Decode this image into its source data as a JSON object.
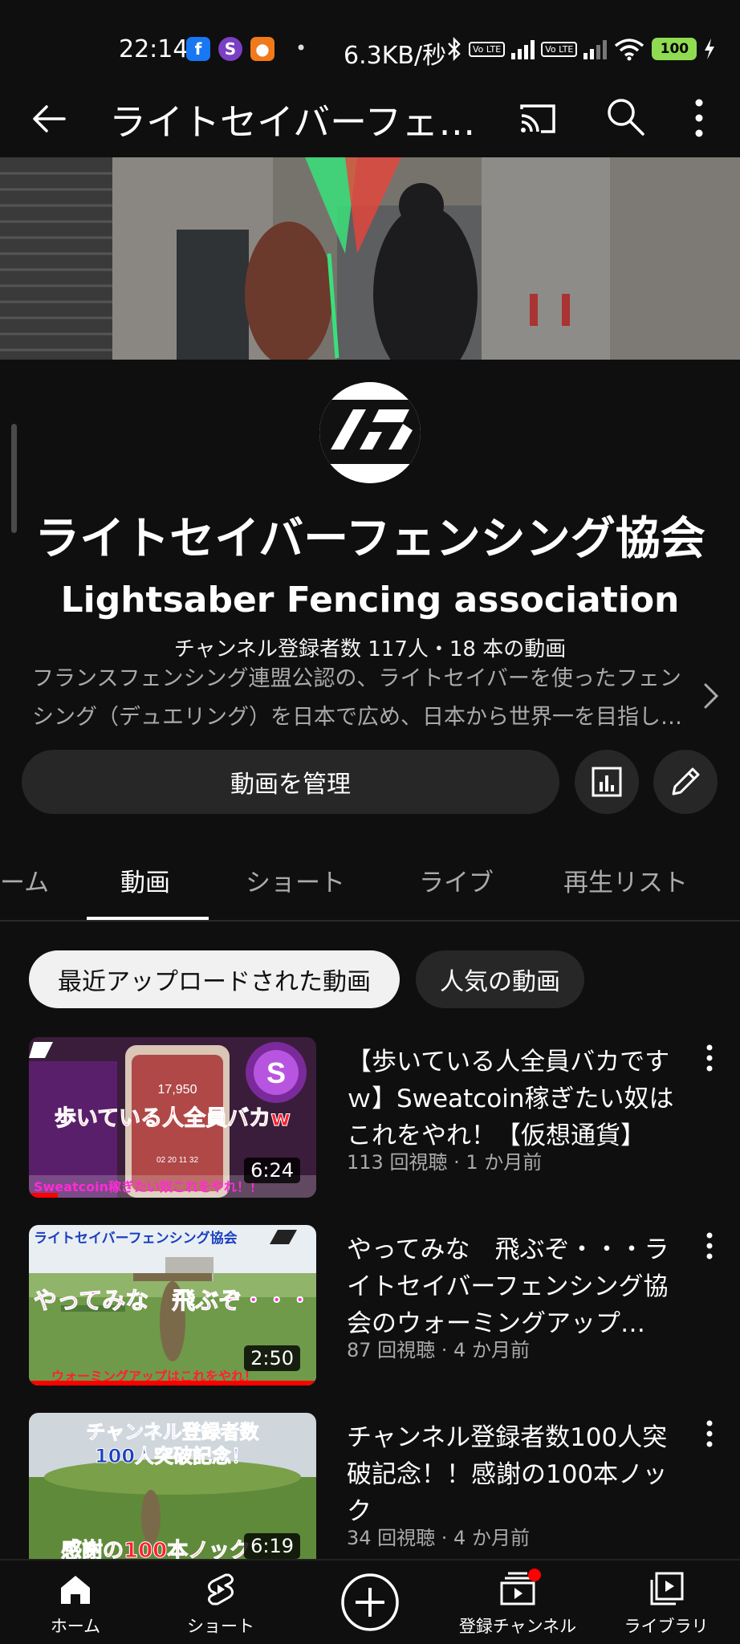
{
  "status_bar": {
    "time": "22:14",
    "net_speed": "6.3KB/秒",
    "volte_label": "Vo LTE",
    "battery": "100"
  },
  "top_bar": {
    "title": "ライトセイバーフェ…"
  },
  "channel": {
    "name": "ライトセイバーフェンシング協会",
    "banner_title": "Lightsaber Fencing association",
    "stats": "チャンネル登録者数 117人・18 本の動画",
    "description": "フランスフェンシング連盟公認の、ライトセイバーを使ったフェンシング（デュエリング）を日本で広め、日本から世界一を目指し…",
    "manage_button": "動画を管理"
  },
  "tabs": [
    {
      "label": "ーム"
    },
    {
      "label": "動画"
    },
    {
      "label": "ショート"
    },
    {
      "label": "ライブ"
    },
    {
      "label": "再生リスト"
    }
  ],
  "chips": {
    "recent": "最近アップロードされた動画",
    "popular": "人気の動画"
  },
  "videos": [
    {
      "title": "【歩いている人全員バカですｗ】Sweatcoin稼ぎたい奴はこれをやれ！【仮想通貨】",
      "meta": "113 回視聴 · 1 か月前",
      "duration": "6:24",
      "thumb_caption": "歩いている人全員バカw",
      "thumb_sub": "Sweatcoin稼ぎたい奴これをやれ！！",
      "thumb_number": "17,950",
      "thumb_time": "02 20 11 32",
      "thumb_s": "S"
    },
    {
      "title": "やってみな　飛ぶぞ・・・ライトセイバーフェンシング協会のウォーミングアップ…",
      "meta": "87 回視聴 · 4 か月前",
      "duration": "2:50",
      "thumb_header": "ライトセイバーフェンシング協会",
      "thumb_caption": "やってみな　飛ぶぞ・・・",
      "thumb_sub": "ウォーミングアップはこれをやれ！"
    },
    {
      "title": "チャンネル登録者数100人突破記念！！感謝の100本ノック",
      "meta": "34 回視聴 · 4 か月前",
      "duration": "6:19",
      "thumb_line1": "チャンネル登録者数",
      "thumb_line2": "100人突破記念！",
      "thumb_caption": "感謝の100本ノック"
    }
  ],
  "bottom_nav": {
    "home": "ホーム",
    "shorts": "ショート",
    "subscriptions": "登録チャンネル",
    "library": "ライブラリ"
  }
}
